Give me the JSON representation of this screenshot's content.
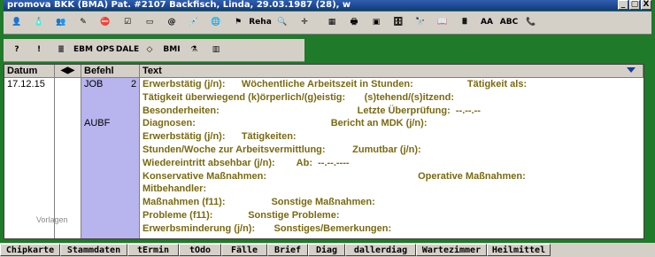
{
  "window": {
    "title": "promova BKK (BMA) Pat. #2107 Backfisch, Linda, 29.03.1987 (28), w",
    "buttons": [
      "_",
      "▢",
      "X"
    ]
  },
  "toolbar1": [
    {
      "name": "patient-icon",
      "glyph": "👤"
    },
    {
      "name": "bottle-icon",
      "glyph": "🧴"
    },
    {
      "name": "people-icon",
      "glyph": "👥"
    },
    {
      "name": "pen-icon",
      "glyph": "✎"
    },
    {
      "name": "stop-icon",
      "glyph": "⛔"
    },
    {
      "name": "checklist-icon",
      "glyph": "☑"
    },
    {
      "name": "card-icon",
      "glyph": "▭"
    },
    {
      "name": "email-icon",
      "glyph": "@"
    },
    {
      "name": "syringe-icon",
      "glyph": "💉"
    },
    {
      "name": "globe-icon",
      "glyph": "🌐"
    },
    {
      "name": "flag-icon",
      "glyph": "⚑"
    },
    {
      "name": "reha-icon",
      "glyph": "Reha"
    },
    {
      "name": "magnifier-icon",
      "glyph": "🔍"
    },
    {
      "name": "crosshair-icon",
      "glyph": "✛"
    },
    {
      "name": "table-icon",
      "glyph": "▦"
    },
    {
      "name": "printer-icon",
      "glyph": "🖶"
    },
    {
      "name": "device-icon",
      "glyph": "▣"
    },
    {
      "name": "cabinet-icon",
      "glyph": "🗄"
    },
    {
      "name": "binoculars-icon",
      "glyph": "🔭"
    },
    {
      "name": "book-icon",
      "glyph": "📖"
    },
    {
      "name": "calculator-icon",
      "glyph": "🖩"
    },
    {
      "name": "font-icon",
      "glyph": "AA"
    },
    {
      "name": "abc-icon",
      "glyph": "ABC"
    },
    {
      "name": "phone-icon",
      "glyph": "📞"
    }
  ],
  "toolbar2": [
    {
      "name": "help-icon",
      "glyph": "?"
    },
    {
      "name": "alert-icon",
      "glyph": "!"
    },
    {
      "name": "list-icon",
      "glyph": "≣"
    },
    {
      "name": "ebm-icon",
      "glyph": "EBM"
    },
    {
      "name": "ops-icon",
      "glyph": "OPS"
    },
    {
      "name": "dale-icon",
      "glyph": "DALE"
    },
    {
      "name": "eraser-icon",
      "glyph": "◇"
    },
    {
      "name": "bmi-icon",
      "glyph": "BMI"
    },
    {
      "name": "flask-icon",
      "glyph": "⚗"
    },
    {
      "name": "chart-icon",
      "glyph": "▥"
    }
  ],
  "grid": {
    "headers": {
      "date": "Datum",
      "nav": "◀▶",
      "command": "Befehl",
      "text": "Text"
    },
    "date": "17.12.15",
    "commands": [
      {
        "label": "JOB",
        "count": "2"
      },
      {
        "label": "AUBF",
        "count": ""
      }
    ],
    "lines": [
      "Erwerbstätig (j/n):      Wöchentliche Arbeitszeit in Stunden:                    Tätigkeit als:",
      "Tätigkeit überwiegend (k)örperlich/(g)eistig:       (s)tehend/(s)itzend:",
      "Besonderheiten:                                                   Letzte Überprüfung:  --.--.--",
      "Diagnosen:                                                  Bericht an MDK (j/n):",
      "Erwerbstätig (j/n):      Tätigkeiten:",
      "Stunden/Woche zur Arbeitsvermittlung:          Zumutbar (j/n):",
      "Wiedereintritt absehbar (j/n):        Ab:  --.--.----",
      "Konservative Maßnahmen:                                                        Operative Maßnahmen:",
      "Mitbehandler:",
      "Maßnahmen (f11):                 Sonstige Maßnahmen:",
      "Probleme (f11):             Sonstige Probleme:",
      "Erwerbsminderung (j/n):       Sonstiges/Bemerkungen:"
    ],
    "watermark": "Vorlagen"
  },
  "tabs": [
    "Chipkarte",
    "Stammdaten",
    "tErmin",
    "tOdo",
    "Fälle",
    "Brief",
    "Diag",
    "dallerdiag",
    "Wartezimmer",
    "Heilmittel"
  ]
}
